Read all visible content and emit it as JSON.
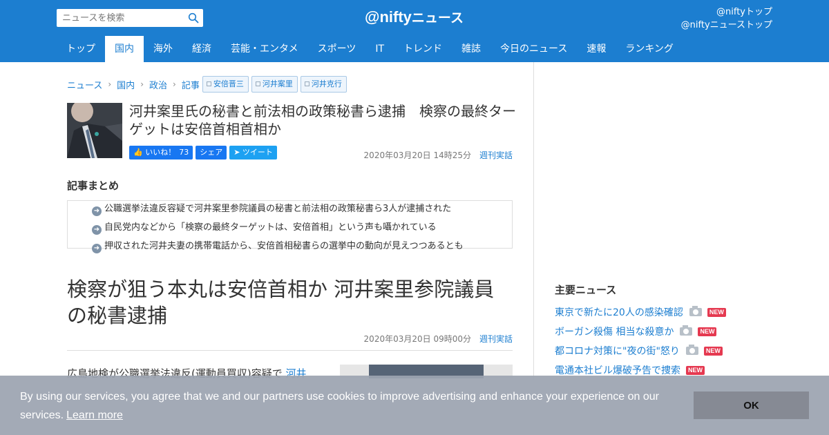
{
  "header": {
    "search_placeholder": "ニュースを検索",
    "logo_main": "@nifty",
    "logo_sub": "ニュース",
    "links": [
      "@niftyトップ",
      "@niftyニューストップ"
    ]
  },
  "nav": [
    "トップ",
    "国内",
    "海外",
    "経済",
    "芸能・エンタメ",
    "スポーツ",
    "IT",
    "トレンド",
    "雑誌",
    "今日のニュース",
    "速報",
    "ランキング"
  ],
  "nav_active": "国内",
  "breadcrumb": [
    "ニュース",
    "国内",
    "政治",
    "記事"
  ],
  "tags": [
    "安倍晋三",
    "河井案里",
    "河井克行"
  ],
  "article": {
    "title": "河井案里氏の秘書と前法相の政策秘書ら逮捕　検察の最終ターゲットは安倍首相首相か",
    "like_label": "いいね！",
    "like_count": "73",
    "share_label": "シェア",
    "tweet_label": "ツイート",
    "date": "2020年03月20日 14時25分",
    "source": "週刊実話"
  },
  "summary": {
    "heading": "記事まとめ",
    "items": [
      "公職選挙法違反容疑で河井案里参院議員の秘書と前法相の政策秘書ら3人が逮捕された",
      "自民党内などから「検察の最終ターゲットは、安倍首相」という声も囁かれている",
      "押収された河井夫妻の携帯電話から、安倍首相秘書らの選挙中の動向が見えつつあるとも"
    ]
  },
  "main": {
    "headline": "検察が狙う本丸は安倍首相か 河井案里参院議員の秘書逮捕",
    "date": "2020年03月20日 09時00分",
    "source": "週刊実話",
    "body_start": "広島地検が公職選挙法違反(運動員買収)容疑で",
    "body_link": "河井"
  },
  "sidebar": {
    "heading": "主要ニュース",
    "news": [
      {
        "title": "東京で新たに20人の感染確認",
        "camera": true,
        "new": "NEW"
      },
      {
        "title": "ボーガン殺傷 相当な殺意か",
        "camera": true,
        "new": "NEW"
      },
      {
        "title": "都コロナ対策に\"夜の街\"怒り",
        "camera": true,
        "new": "NEW"
      },
      {
        "title": "電通本社ビル爆破予告で捜索",
        "camera": false,
        "new": "NEW"
      }
    ]
  },
  "cookie": {
    "text": "By using our services, you agree that we and our partners use cookies to improve advertising and enhance your experience on our services.",
    "learn_more": "Learn more",
    "ok": "OK"
  },
  "colors": {
    "brand_blue": "#1c7ed0",
    "new_badge": "#e53950",
    "facebook": "#1877f2",
    "twitter": "#1da1f2"
  }
}
